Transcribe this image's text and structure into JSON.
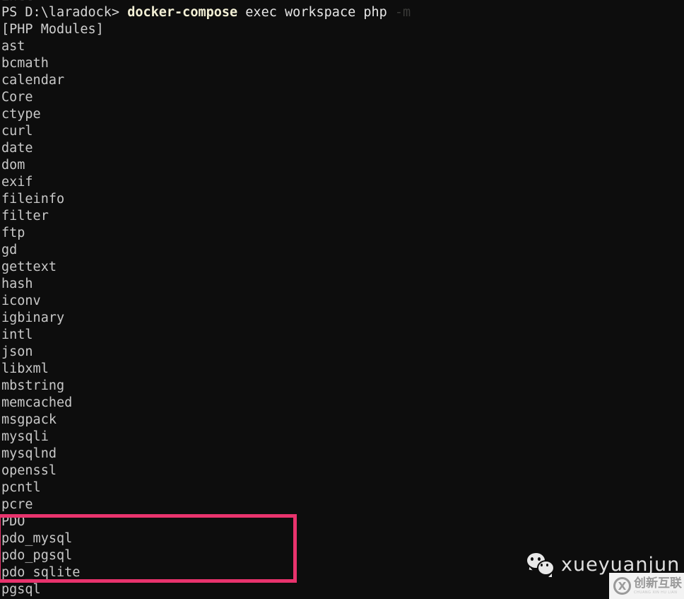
{
  "terminal": {
    "scrolled_remnant": "intl",
    "background_color": "#0d0d0d",
    "prompt": {
      "prefix": "PS D:\\laradock> ",
      "command": "docker-compose",
      "args": " exec workspace php ",
      "flag": "-m"
    },
    "output_header": "[PHP Modules]",
    "modules": [
      "ast",
      "bcmath",
      "calendar",
      "Core",
      "ctype",
      "curl",
      "date",
      "dom",
      "exif",
      "fileinfo",
      "filter",
      "ftp",
      "gd",
      "gettext",
      "hash",
      "iconv",
      "igbinary",
      "intl",
      "json",
      "libxml",
      "mbstring",
      "memcached",
      "msgpack",
      "mysqli",
      "mysqlnd",
      "openssl",
      "pcntl",
      "pcre",
      "PDO",
      "pdo_mysql",
      "pdo_pgsql",
      "pdo_sqlite",
      "pgsql"
    ],
    "highlight": {
      "color": "#e8336d",
      "modules": [
        "PDO",
        "pdo_mysql",
        "pdo_pgsql",
        "pdo_sqlite"
      ]
    }
  },
  "watermarks": {
    "wechat": {
      "icon": "wechat-icon",
      "name": "xueyuanjun"
    },
    "badge": {
      "logo_letter": "X",
      "cn_text": "创新互联",
      "en_text": "CHUANG XIN HU LIAN"
    }
  }
}
